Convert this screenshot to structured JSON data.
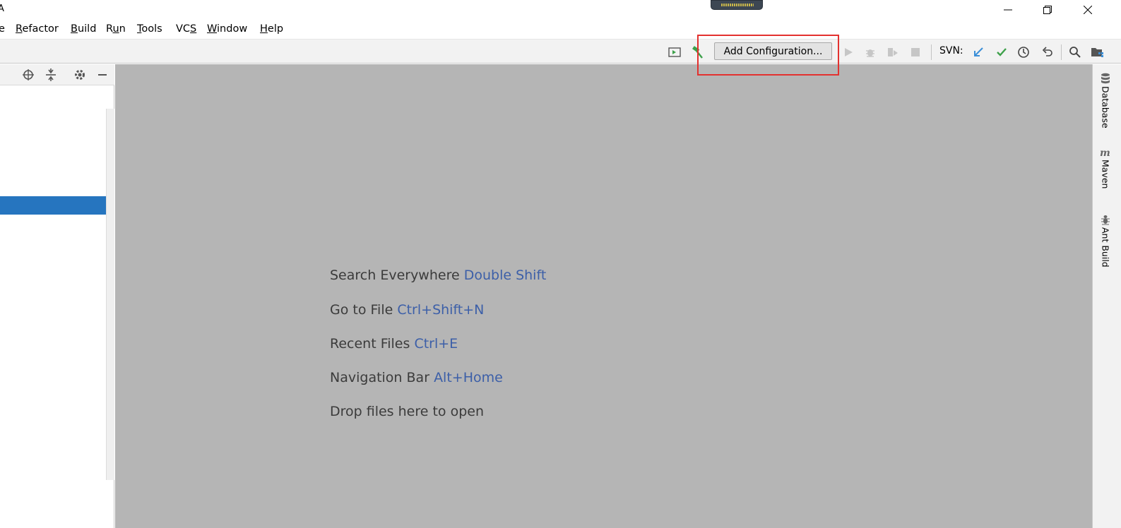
{
  "window": {
    "title_fragment": "A"
  },
  "menu": {
    "items": [
      {
        "label": "e",
        "mnemonic": ""
      },
      {
        "label": "Refactor",
        "mnemonic": "R"
      },
      {
        "label": "Build",
        "mnemonic": "B"
      },
      {
        "label": "Run",
        "mnemonic": "u"
      },
      {
        "label": "Tools",
        "mnemonic": "T"
      },
      {
        "label": "VCS",
        "mnemonic": "S"
      },
      {
        "label": "Window",
        "mnemonic": "W"
      },
      {
        "label": "Help",
        "mnemonic": "H"
      }
    ]
  },
  "toolbar": {
    "add_configuration_label": "Add Configuration...",
    "svn_label": "SVN:"
  },
  "editor": {
    "hints": [
      {
        "text": "Search Everywhere",
        "shortcut": "Double Shift"
      },
      {
        "text": "Go to File",
        "shortcut": "Ctrl+Shift+N"
      },
      {
        "text": "Recent Files",
        "shortcut": "Ctrl+E"
      },
      {
        "text": "Navigation Bar",
        "shortcut": "Alt+Home"
      },
      {
        "text": "Drop files here to open",
        "shortcut": ""
      }
    ]
  },
  "right_tools": {
    "database": "Database",
    "maven": "Maven",
    "ant_build": "Ant Build"
  },
  "colors": {
    "editor_bg": "#b5b5b5",
    "shortcut_blue": "#3c5fa8",
    "selection_blue": "#2675bf",
    "highlight_red": "#e3312f",
    "svn_blue": "#3b8fd8",
    "svn_green": "#3ea14b"
  }
}
